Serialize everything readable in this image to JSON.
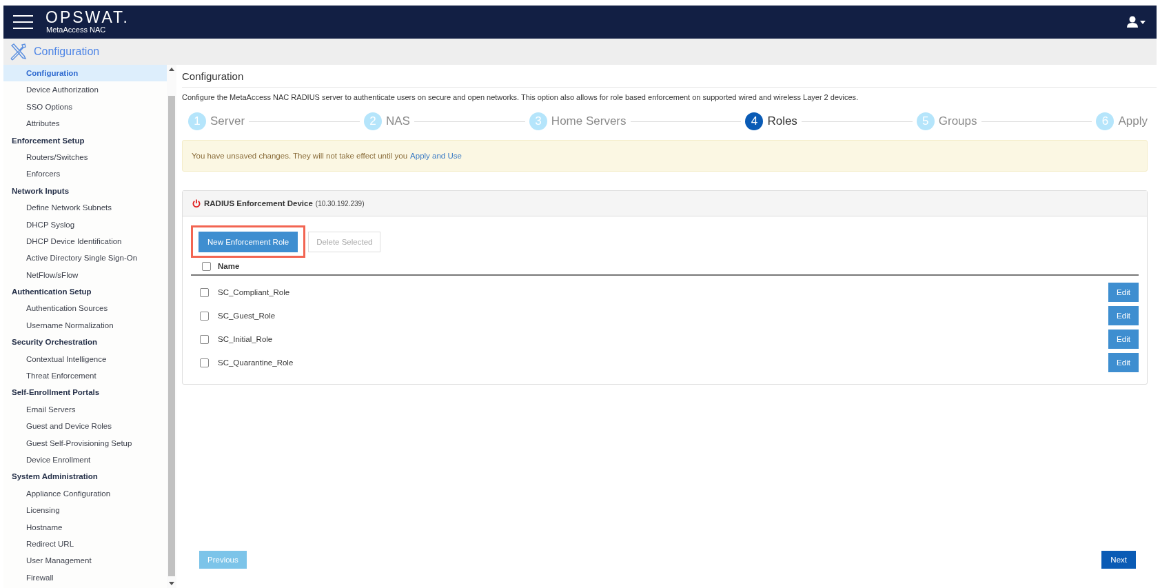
{
  "header": {
    "brand": "OPSWAT.",
    "product": "MetaAccess NAC"
  },
  "subheader": {
    "title": "Configuration"
  },
  "sidebar": {
    "items": [
      {
        "kind": "link",
        "label": "Configuration",
        "selected": true
      },
      {
        "kind": "link",
        "label": "Device Authorization",
        "selected": false
      },
      {
        "kind": "link",
        "label": "SSO Options",
        "selected": false
      },
      {
        "kind": "link",
        "label": "Attributes",
        "selected": false
      },
      {
        "kind": "heading",
        "label": "Enforcement Setup",
        "children": [
          {
            "kind": "link",
            "label": "Routers/Switches",
            "selected": false
          },
          {
            "kind": "link",
            "label": "Enforcers",
            "selected": false
          }
        ]
      },
      {
        "kind": "heading",
        "label": "Network Inputs",
        "children": [
          {
            "kind": "link",
            "label": "Define Network Subnets",
            "selected": false
          },
          {
            "kind": "link",
            "label": "DHCP Syslog",
            "selected": false
          },
          {
            "kind": "link",
            "label": "DHCP Device Identification",
            "selected": false
          },
          {
            "kind": "link",
            "label": "Active Directory Single Sign-On",
            "selected": false
          },
          {
            "kind": "link",
            "label": "NetFlow/sFlow",
            "selected": false
          }
        ]
      },
      {
        "kind": "heading",
        "label": "Authentication Setup",
        "children": [
          {
            "kind": "link",
            "label": "Authentication Sources",
            "selected": false
          },
          {
            "kind": "link",
            "label": "Username Normalization",
            "selected": false
          }
        ]
      },
      {
        "kind": "heading",
        "label": "Security Orchestration",
        "children": [
          {
            "kind": "link",
            "label": "Contextual Intelligence",
            "selected": false
          },
          {
            "kind": "link",
            "label": "Threat Enforcement",
            "selected": false
          }
        ]
      },
      {
        "kind": "heading",
        "label": "Self-Enrollment Portals",
        "children": [
          {
            "kind": "link",
            "label": "Email Servers",
            "selected": false
          },
          {
            "kind": "link",
            "label": "Guest and Device Roles",
            "selected": false
          },
          {
            "kind": "link",
            "label": "Guest Self-Provisioning Setup",
            "selected": false
          },
          {
            "kind": "link",
            "label": "Device Enrollment",
            "selected": false
          }
        ]
      },
      {
        "kind": "heading",
        "label": "System Administration",
        "children": [
          {
            "kind": "link",
            "label": "Appliance Configuration",
            "selected": false
          },
          {
            "kind": "link",
            "label": "Licensing",
            "selected": false
          },
          {
            "kind": "link",
            "label": "Hostname",
            "selected": false
          },
          {
            "kind": "link",
            "label": "Redirect URL",
            "selected": false
          },
          {
            "kind": "link",
            "label": "User Management",
            "selected": false
          },
          {
            "kind": "link",
            "label": "Firewall",
            "selected": false
          }
        ]
      }
    ]
  },
  "page": {
    "title": "Configuration",
    "description": "Configure the MetaAccess NAC RADIUS server to authenticate users on secure and open networks. This option also allows for role based enforcement on supported wired and wireless Layer 2 devices."
  },
  "steps": [
    {
      "number": "1",
      "label": "Server",
      "selected": false
    },
    {
      "number": "2",
      "label": "NAS",
      "selected": false
    },
    {
      "number": "3",
      "label": "Home Servers",
      "selected": false
    },
    {
      "number": "4",
      "label": "Roles",
      "selected": true
    },
    {
      "number": "5",
      "label": "Groups",
      "selected": false
    },
    {
      "number": "6",
      "label": "Apply",
      "selected": false
    }
  ],
  "alert": {
    "text": "You have unsaved changes. They will not take effect until you",
    "link": "Apply and Use"
  },
  "panel": {
    "title": "RADIUS Enforcement Device",
    "address": "(10.30.192.239)",
    "new_button": {
      "label": "New Enforcement Role",
      "highlighted": true
    },
    "delete_button": {
      "label": "Delete Selected",
      "disabled": true
    },
    "table": {
      "column": "Name",
      "all_checked": false,
      "rows": [
        {
          "name": "SC_Compliant_Role",
          "checked": false,
          "action": "Edit"
        },
        {
          "name": "SC_Guest_Role",
          "checked": false,
          "action": "Edit"
        },
        {
          "name": "SC_Initial_Role",
          "checked": false,
          "action": "Edit"
        },
        {
          "name": "SC_Quarantine_Role",
          "checked": false,
          "action": "Edit"
        }
      ]
    }
  },
  "footer": {
    "previous": "Previous",
    "next": "Next"
  }
}
